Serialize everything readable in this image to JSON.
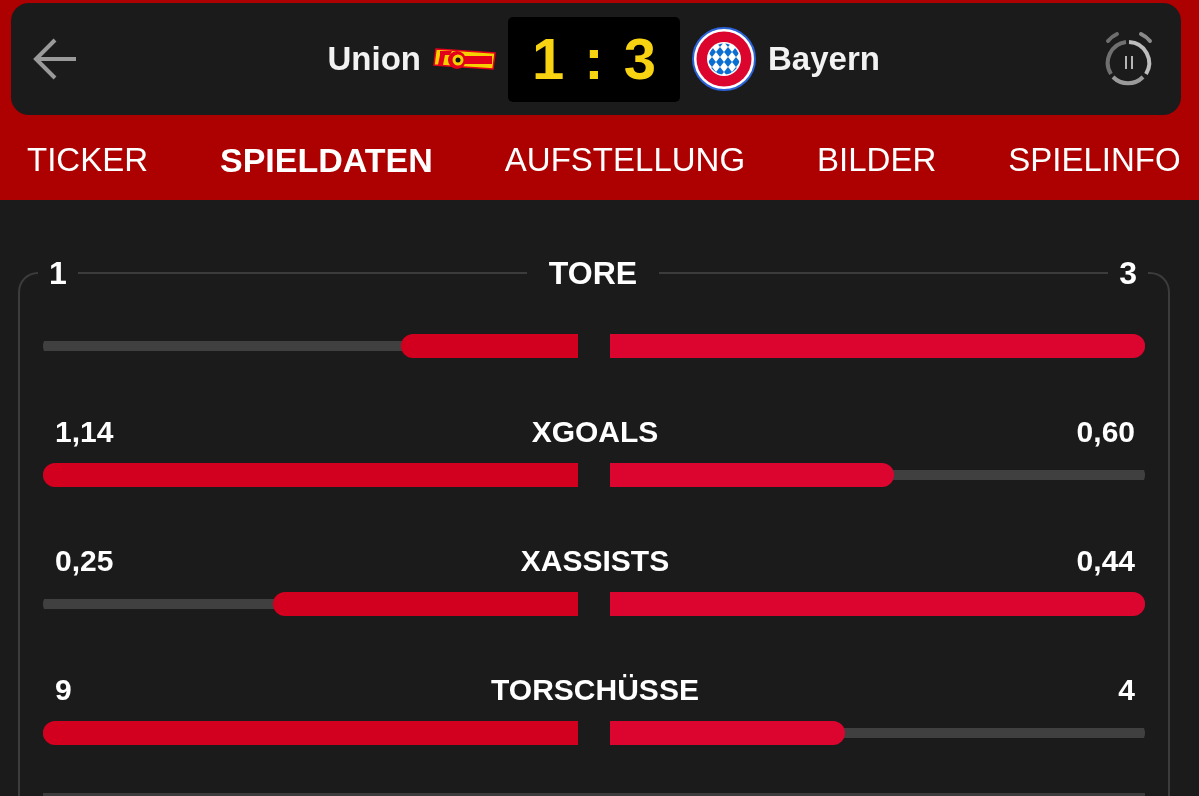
{
  "match": {
    "home": {
      "name": "Union"
    },
    "score": {
      "home": "1",
      "separator": ":",
      "away": "3"
    },
    "away": {
      "name": "Bayern"
    }
  },
  "tabs": [
    {
      "label": "TICKER",
      "selected": false
    },
    {
      "label": "SPIELDATEN",
      "selected": true
    },
    {
      "label": "AUFSTELLUNG",
      "selected": false
    },
    {
      "label": "BILDER",
      "selected": false
    },
    {
      "label": "SPIELINFO",
      "selected": false
    }
  ],
  "stats": [
    {
      "kind": "header",
      "label": "TORE",
      "home": {
        "value": "1",
        "level": 0.33
      },
      "away": {
        "value": "3",
        "level": 1
      }
    },
    {
      "kind": "row",
      "label": "XGOALS",
      "home": {
        "value": "1,14",
        "level": 1
      },
      "away": {
        "value": "0,60",
        "level": 0.53
      }
    },
    {
      "kind": "row",
      "label": "XASSISTS",
      "home": {
        "value": "0,25",
        "level": 0.57
      },
      "away": {
        "value": "0,44",
        "level": 1
      }
    },
    {
      "kind": "row",
      "label": "TORSCHÜSSE",
      "home": {
        "value": "9",
        "level": 1
      },
      "away": {
        "value": "4",
        "level": 0.44
      }
    }
  ]
}
